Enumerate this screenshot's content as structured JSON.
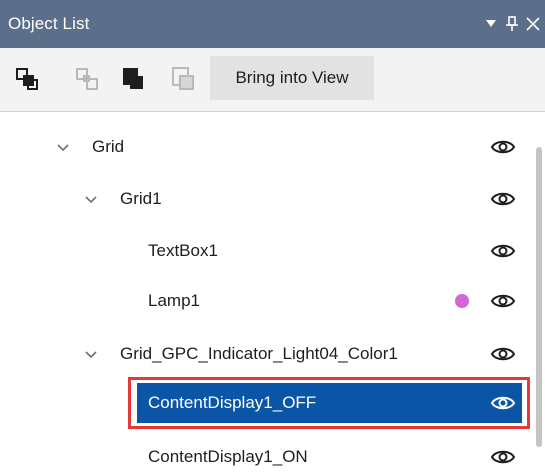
{
  "window": {
    "title": "Object List"
  },
  "toolbar": {
    "buttons": [
      {
        "icon": "bring-forward-icon",
        "enabled": true
      },
      {
        "icon": "send-backward-icon",
        "enabled": false
      },
      {
        "icon": "bring-to-front-icon",
        "enabled": true
      },
      {
        "icon": "send-to-back-icon",
        "enabled": false
      }
    ],
    "bring_into_view_label": "Bring into View"
  },
  "tree": {
    "items": [
      {
        "label": "Grid",
        "level": 0,
        "expanded": true,
        "visible": true
      },
      {
        "label": "Grid1",
        "level": 1,
        "expanded": true,
        "visible": true
      },
      {
        "label": "TextBox1",
        "level": 2,
        "visible": true
      },
      {
        "label": "Lamp1",
        "level": 2,
        "visible": true,
        "status_color": "#d265d8"
      },
      {
        "label": "Grid_GPC_Indicator_Light04_Color1",
        "level": 1,
        "expanded": true,
        "visible": true
      },
      {
        "label": "ContentDisplay1_OFF",
        "level": 2,
        "visible": true,
        "selected": true
      },
      {
        "label": "ContentDisplay1_ON",
        "level": 2,
        "visible": true
      }
    ]
  },
  "colors": {
    "titlebar": "#5c6f8a",
    "selection": "#0b55a6",
    "highlight": "#e5383b",
    "lamp_dot": "#d265d8"
  }
}
